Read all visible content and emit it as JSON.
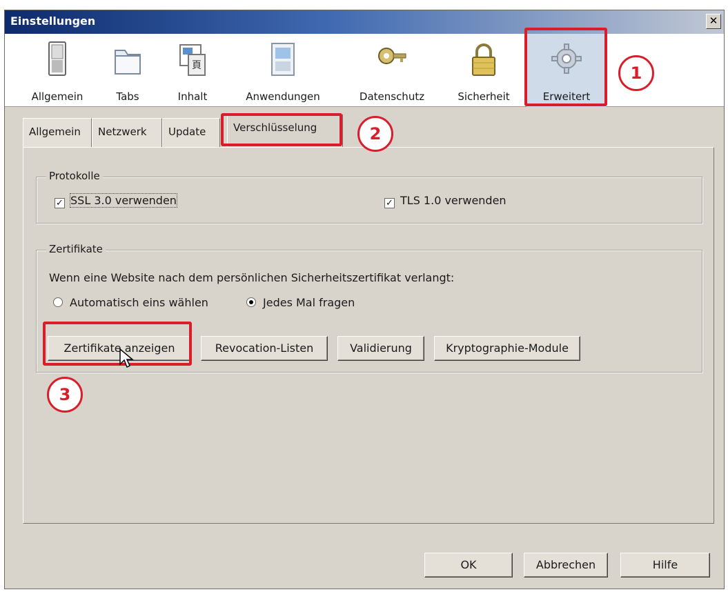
{
  "window": {
    "title": "Einstellungen",
    "close_glyph": "✕"
  },
  "toolbar": {
    "items": [
      {
        "label": "Allgemein",
        "icon": "switch-icon"
      },
      {
        "label": "Tabs",
        "icon": "folder-icon"
      },
      {
        "label": "Inhalt",
        "icon": "content-icon"
      },
      {
        "label": "Anwendungen",
        "icon": "applications-icon"
      },
      {
        "label": "Datenschutz",
        "icon": "key-icon"
      },
      {
        "label": "Sicherheit",
        "icon": "lock-icon"
      },
      {
        "label": "Erweitert",
        "icon": "gear-icon",
        "selected": true
      }
    ]
  },
  "subtabs": [
    {
      "label": "Allgemein"
    },
    {
      "label": "Netzwerk"
    },
    {
      "label": "Update"
    },
    {
      "label": "Verschlüsselung",
      "active": true
    }
  ],
  "protocols": {
    "legend": "Protokolle",
    "ssl_label": "SSL 3.0 verwenden",
    "ssl_checked": true,
    "tls_label": "TLS 1.0 verwenden",
    "tls_checked": true
  },
  "certificates": {
    "legend": "Zertifikate",
    "prompt": "Wenn eine Website nach dem persönlichen Sicherheitszertifikat verlangt:",
    "radio_auto": "Automatisch eins wählen",
    "radio_ask": "Jedes Mal fragen",
    "selected": "ask",
    "buttons": {
      "show": "Zertifikate anzeigen",
      "revocation": "Revocation-Listen",
      "validation": "Validierung",
      "crypto": "Kryptographie-Module"
    }
  },
  "annotations": {
    "step1": "1",
    "step2": "2",
    "step3": "3",
    "color": "#d91d2a"
  },
  "footer": {
    "ok": "OK",
    "cancel": "Abbrechen",
    "help": "Hilfe"
  },
  "colors": {
    "title_start": "#0d2a6c",
    "title_end": "#c1c8d4",
    "dialog_bg": "#d8d4cc",
    "selected_toolbar": "#cfdbe9"
  }
}
